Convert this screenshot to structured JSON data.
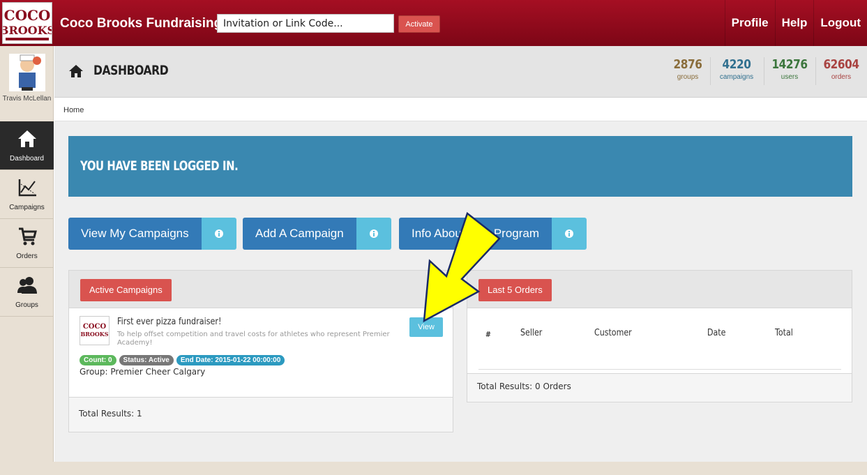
{
  "app": {
    "brand": "Coco Brooks Fundraising",
    "logo_alt": "Coco Brooks"
  },
  "topbar": {
    "code_placeholder": "Invitation or Link Code...",
    "activate_label": "Activate",
    "nav": [
      {
        "label": "Profile"
      },
      {
        "label": "Help"
      },
      {
        "label": "Logout"
      }
    ]
  },
  "sidebar": {
    "user_name": "Travis McLellan",
    "items": [
      {
        "label": "Dashboard",
        "icon": "home-icon",
        "active": true
      },
      {
        "label": "Campaigns",
        "icon": "chart-icon",
        "active": false
      },
      {
        "label": "Orders",
        "icon": "cart-icon",
        "active": false
      },
      {
        "label": "Groups",
        "icon": "users-icon",
        "active": false
      }
    ]
  },
  "header": {
    "title": "DASHBOARD",
    "stats": [
      {
        "value": "2876",
        "label": "groups",
        "color": "#8a6d3b"
      },
      {
        "value": "4220",
        "label": "campaigns",
        "color": "#31708f"
      },
      {
        "value": "14276",
        "label": "users",
        "color": "#3c763d"
      },
      {
        "value": "62604",
        "label": "orders",
        "color": "#a94442"
      }
    ]
  },
  "breadcrumb": {
    "home": "Home"
  },
  "alert": {
    "message": "YOU HAVE BEEN LOGGED IN."
  },
  "actions": [
    {
      "label": "View My Campaigns"
    },
    {
      "label": "Add A Campaign"
    },
    {
      "label": "Info About This Program"
    }
  ],
  "active_campaigns": {
    "title": "Active Campaigns",
    "campaign": {
      "name": "First ever pizza fundraiser!",
      "description": "To help offset competition and travel costs for athletes who represent Premier Academy!",
      "count": "Count: 0",
      "status": "Status: Active",
      "end_date": "End Date: 2015-01-22 00:00:00",
      "group": "Group: Premier Cheer Calgary",
      "view_label": "View"
    },
    "total": "Total Results: 1"
  },
  "last_orders": {
    "title": "Last 5 Orders",
    "columns": [
      "#",
      "Seller",
      "Customer",
      "Date",
      "Total"
    ],
    "total": "Total Results: 0 Orders"
  },
  "colors": {
    "topbar": "#9a0c20",
    "primary": "#337ab7",
    "info": "#5bc0de",
    "danger": "#d9534f",
    "alert": "#3a88b0",
    "arrow": "#ffff00"
  }
}
